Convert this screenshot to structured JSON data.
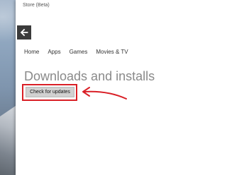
{
  "window": {
    "title": "Store (Beta)"
  },
  "nav": {
    "items": [
      {
        "label": "Home"
      },
      {
        "label": "Apps"
      },
      {
        "label": "Games"
      },
      {
        "label": "Movies & TV"
      }
    ]
  },
  "main": {
    "heading": "Downloads and installs",
    "check_updates_label": "Check for updates"
  },
  "icons": {
    "back": "back-arrow-icon",
    "annotation": "red-arrow-icon"
  },
  "colors": {
    "annotation_red": "#d91f26",
    "back_button_bg": "#3b3b3b",
    "button_bg": "#d1d1d1"
  }
}
